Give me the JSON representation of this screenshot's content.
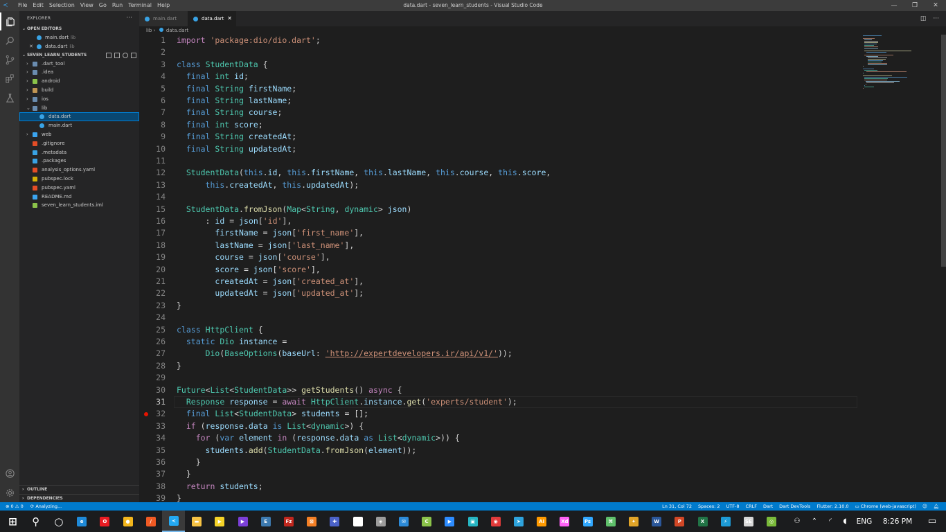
{
  "window": {
    "title": "data.dart - seven_learn_students - Visual Studio Code",
    "menu": [
      "File",
      "Edit",
      "Selection",
      "View",
      "Go",
      "Run",
      "Terminal",
      "Help"
    ]
  },
  "sidebar": {
    "title": "EXPLORER",
    "open_editors_label": "OPEN EDITORS",
    "open_editors": [
      {
        "name": "main.dart",
        "path": "lib"
      },
      {
        "name": "data.dart",
        "path": "lib"
      }
    ],
    "project_label": "SEVEN_LEARN_STUDENTS",
    "tree": [
      {
        "name": ".dart_tool",
        "type": "folder",
        "depth": 1,
        "icon_color": "#6a8caf"
      },
      {
        "name": ".idea",
        "type": "folder",
        "depth": 1,
        "icon_color": "#6a8caf"
      },
      {
        "name": "android",
        "type": "folder",
        "depth": 1,
        "icon_color": "#8bc34a"
      },
      {
        "name": "build",
        "type": "folder",
        "depth": 1,
        "icon_color": "#c09553"
      },
      {
        "name": "ios",
        "type": "folder",
        "depth": 1,
        "icon_color": "#6a8caf"
      },
      {
        "name": "lib",
        "type": "folder-open",
        "depth": 1,
        "icon_color": "#6a8caf"
      },
      {
        "name": "data.dart",
        "type": "file",
        "depth": 2,
        "icon_color": "#39a3e5"
      },
      {
        "name": "main.dart",
        "type": "file",
        "depth": 2,
        "icon_color": "#39a3e5"
      },
      {
        "name": "web",
        "type": "folder",
        "depth": 1,
        "icon_color": "#3ba4f0"
      },
      {
        "name": ".gitignore",
        "type": "file",
        "depth": 1,
        "icon_color": "#e44d26"
      },
      {
        "name": ".metadata",
        "type": "file",
        "depth": 1,
        "icon_color": "#39a3e5"
      },
      {
        "name": ".packages",
        "type": "file",
        "depth": 1,
        "icon_color": "#39a3e5"
      },
      {
        "name": "analysis_options.yaml",
        "type": "file",
        "depth": 1,
        "icon_color": "#e44d26"
      },
      {
        "name": "pubspec.lock",
        "type": "file",
        "depth": 1,
        "icon_color": "#d4b106"
      },
      {
        "name": "pubspec.yaml",
        "type": "file",
        "depth": 1,
        "icon_color": "#e44d26"
      },
      {
        "name": "README.md",
        "type": "file",
        "depth": 1,
        "icon_color": "#3ba4f0"
      },
      {
        "name": "seven_learn_students.iml",
        "type": "file",
        "depth": 1,
        "icon_color": "#8bc34a"
      }
    ],
    "outline_label": "OUTLINE",
    "dependencies_label": "DEPENDENCIES"
  },
  "tabs": [
    {
      "name": "main.dart",
      "active": false
    },
    {
      "name": "data.dart",
      "active": true
    }
  ],
  "breadcrumb": [
    "lib",
    "data.dart"
  ],
  "editor": {
    "current_line": 31,
    "breakpoint_line": 32,
    "lines": [
      "import 'package:dio/dio.dart';",
      "",
      "class StudentData {",
      "  final int id;",
      "  final String firstName;",
      "  final String lastName;",
      "  final String course;",
      "  final int score;",
      "  final String createdAt;",
      "  final String updatedAt;",
      "",
      "  StudentData(this.id, this.firstName, this.lastName, this.course, this.score,",
      "      this.createdAt, this.updatedAt);",
      "",
      "  StudentData.fromJson(Map<String, dynamic> json)",
      "      : id = json['id'],",
      "        firstName = json['first_name'],",
      "        lastName = json['last_name'],",
      "        course = json['course'],",
      "        score = json['score'],",
      "        createdAt = json['created_at'],",
      "        updatedAt = json['updated_at'];",
      "}",
      "",
      "class HttpClient {",
      "  static Dio instance =",
      "      Dio(BaseOptions(baseUrl: 'http://expertdevelopers.ir/api/v1/'));",
      "}",
      "",
      "Future<List<StudentData>> getStudents() async {",
      "  Response response = await HttpClient.instance.get('experts/student');",
      "  final List<StudentData> students = [];",
      "  if (response.data is List<dynamic>) {",
      "    for (var element in (response.data as List<dynamic>)) {",
      "      students.add(StudentData.fromJson(element));",
      "    }",
      "  }",
      "  return students;",
      "}"
    ]
  },
  "statusbar": {
    "errors": "0",
    "warnings": "0",
    "analyzing": "Analyzing...",
    "position": "Ln 31, Col 72",
    "spaces": "Spaces: 2",
    "encoding": "UTF-8",
    "eol": "CRLF",
    "language": "Dart",
    "devtools": "Dart DevTools",
    "flutter": "Flutter: 2.10.0",
    "device": "Chrome (web-javascript)"
  },
  "taskbar": {
    "apps": [
      {
        "name": "windows-start",
        "color": "#ffffff",
        "glyph": "⊞"
      },
      {
        "name": "search",
        "color": "#ffffff",
        "glyph": "⚲"
      },
      {
        "name": "cortana",
        "color": "#ffffff",
        "glyph": "○"
      },
      {
        "name": "edge",
        "color": "#1f8ad8",
        "glyph": "e"
      },
      {
        "name": "opera",
        "color": "#e81c23",
        "glyph": "O"
      },
      {
        "name": "chrome",
        "color": "#f3b61c",
        "glyph": "●"
      },
      {
        "name": "brave",
        "color": "#f05a24",
        "glyph": "/"
      },
      {
        "name": "vscode",
        "color": "#23a9f2",
        "glyph": "≺",
        "active": true
      },
      {
        "name": "file-explorer",
        "color": "#f6c244",
        "glyph": "▬"
      },
      {
        "name": "media-player",
        "color": "#f5d328",
        "glyph": "▶"
      },
      {
        "name": "video-app",
        "color": "#7b3fd8",
        "glyph": "▶"
      },
      {
        "name": "terminal",
        "color": "#3d7ab0",
        "glyph": "E"
      },
      {
        "name": "filezilla",
        "color": "#c0271e",
        "glyph": "Fz"
      },
      {
        "name": "xampp",
        "color": "#f47f25",
        "glyph": "⊠"
      },
      {
        "name": "app-blue",
        "color": "#4b62c8",
        "glyph": "✚"
      },
      {
        "name": "app-grid",
        "color": "#ffffff",
        "glyph": "▦"
      },
      {
        "name": "app-cube",
        "color": "#9c9c9c",
        "glyph": "◈"
      },
      {
        "name": "mail",
        "color": "#2c8ad8",
        "glyph": "✉"
      },
      {
        "name": "android-studio",
        "color": "#8bc34a",
        "glyph": "C"
      },
      {
        "name": "zoom",
        "color": "#2d8cff",
        "glyph": "▶"
      },
      {
        "name": "app-teal",
        "color": "#26b5c3",
        "glyph": "▣"
      },
      {
        "name": "app-dots",
        "color": "#e23a3a",
        "glyph": "◉"
      },
      {
        "name": "telegram",
        "color": "#2ea3dd",
        "glyph": "➤"
      },
      {
        "name": "illustrator",
        "color": "#ff9a00",
        "glyph": "Ai"
      },
      {
        "name": "xd",
        "color": "#ff61f6",
        "glyph": "Xd"
      },
      {
        "name": "photoshop",
        "color": "#31a8ff",
        "glyph": "Ps"
      },
      {
        "name": "app-xml",
        "color": "#5fbf6b",
        "glyph": "⌘"
      },
      {
        "name": "app-game",
        "color": "#e0a428",
        "glyph": "✦"
      },
      {
        "name": "word",
        "color": "#2b579a",
        "glyph": "W"
      },
      {
        "name": "powerpoint",
        "color": "#d24726",
        "glyph": "P"
      },
      {
        "name": "excel",
        "color": "#217346",
        "glyph": "X"
      },
      {
        "name": "app-leaf",
        "color": "#1d9ad6",
        "glyph": "⚡"
      },
      {
        "name": "app-box",
        "color": "#d7d7d7",
        "glyph": "SE"
      },
      {
        "name": "app-orbit",
        "color": "#7aba3a",
        "glyph": "◎"
      }
    ],
    "language": "ENG",
    "time": "8:26 PM"
  },
  "colors": {
    "titlebar": "#3c3c3c",
    "activitybar": "#333333",
    "sidebar": "#252526",
    "editor": "#1e1e1e",
    "statusbar": "#007acc",
    "taskbar": "#1b1c1e",
    "selection": "#094771"
  }
}
